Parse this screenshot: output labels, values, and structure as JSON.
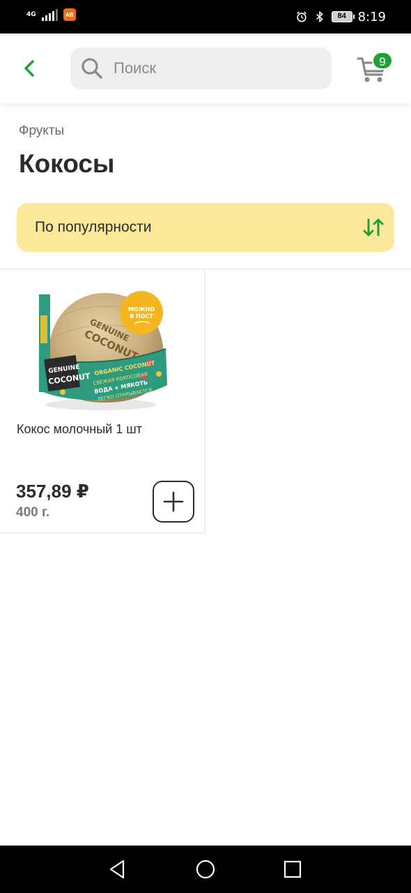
{
  "status_bar": {
    "network": "4G",
    "app_badge": "AB",
    "battery": "84",
    "time": "8:19"
  },
  "header": {
    "search_placeholder": "Поиск",
    "cart_count": "9"
  },
  "breadcrumb": "Фрукты",
  "title": "Кокосы",
  "sort": {
    "label": "По популярности"
  },
  "products": [
    {
      "name": "Кокос молочный 1 шт",
      "price": "357,89 ₽",
      "weight": "400 г.",
      "image": {
        "badge_line1": "МОЖНО",
        "badge_line2": "В ПОСТ",
        "brand_top1": "GENUINE",
        "brand_top2": "COCONUT",
        "brand_label1": "GENUINE",
        "brand_label2": "COCONUT",
        "organic": "ORGANIC COCONUT",
        "tagline1": "СВЕЖАЯ КОКОСОВАЯ",
        "tagline2": "ВОДА + МЯКОТЬ",
        "tagline3": "ЛЕГКО ОТКРЫВАЕТСЯ"
      }
    }
  ],
  "colors": {
    "accent_green": "#21a038",
    "sort_background": "#fce89a",
    "search_background": "#eeeeee"
  },
  "icons": [
    "back-arrow-icon",
    "search-icon",
    "cart-icon",
    "sort-arrows-icon",
    "plus-icon",
    "nav-back-icon",
    "nav-home-icon",
    "nav-recents-icon"
  ]
}
